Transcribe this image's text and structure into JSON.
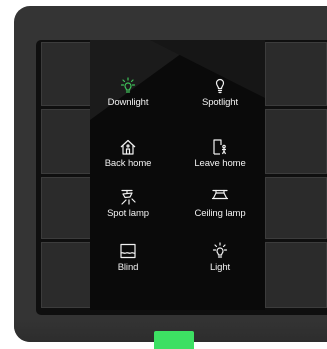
{
  "device": {
    "accent_color": "#3de063",
    "active_color": "#3fc35a"
  },
  "scenes": [
    {
      "label": "Downlight",
      "icon": "downlight-icon",
      "active": true
    },
    {
      "label": "Spotlight",
      "icon": "spotlight-icon",
      "active": false
    },
    {
      "label": "Back home",
      "icon": "back-home-icon",
      "active": false
    },
    {
      "label": "Leave home",
      "icon": "leave-home-icon",
      "active": false
    },
    {
      "label": "Spot lamp",
      "icon": "spot-lamp-icon",
      "active": false
    },
    {
      "label": "Ceiling lamp",
      "icon": "ceiling-lamp-icon",
      "active": false
    },
    {
      "label": "Blind",
      "icon": "blind-icon",
      "active": false
    },
    {
      "label": "Light",
      "icon": "light-icon",
      "active": false
    }
  ]
}
